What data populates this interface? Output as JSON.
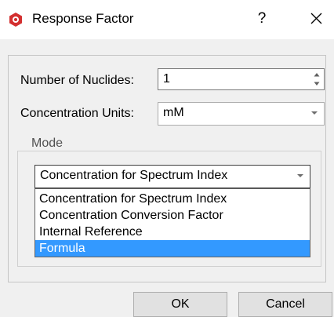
{
  "window": {
    "title": "Response Factor",
    "help_label": "?",
    "icon": "app-logo-icon",
    "accent": "#3399ff"
  },
  "form": {
    "nuclides_label": "Number of Nuclides:",
    "nuclides_value": "1",
    "units_label": "Concentration Units:",
    "units_value": "mM"
  },
  "mode": {
    "group_label": "Mode",
    "selected_value": "Concentration for Spectrum Index",
    "options": [
      "Concentration for Spectrum Index",
      "Concentration Conversion Factor",
      "Internal Reference",
      "Formula"
    ],
    "highlighted_option": "Formula"
  },
  "buttons": {
    "ok_label": "OK",
    "cancel_label": "Cancel"
  }
}
